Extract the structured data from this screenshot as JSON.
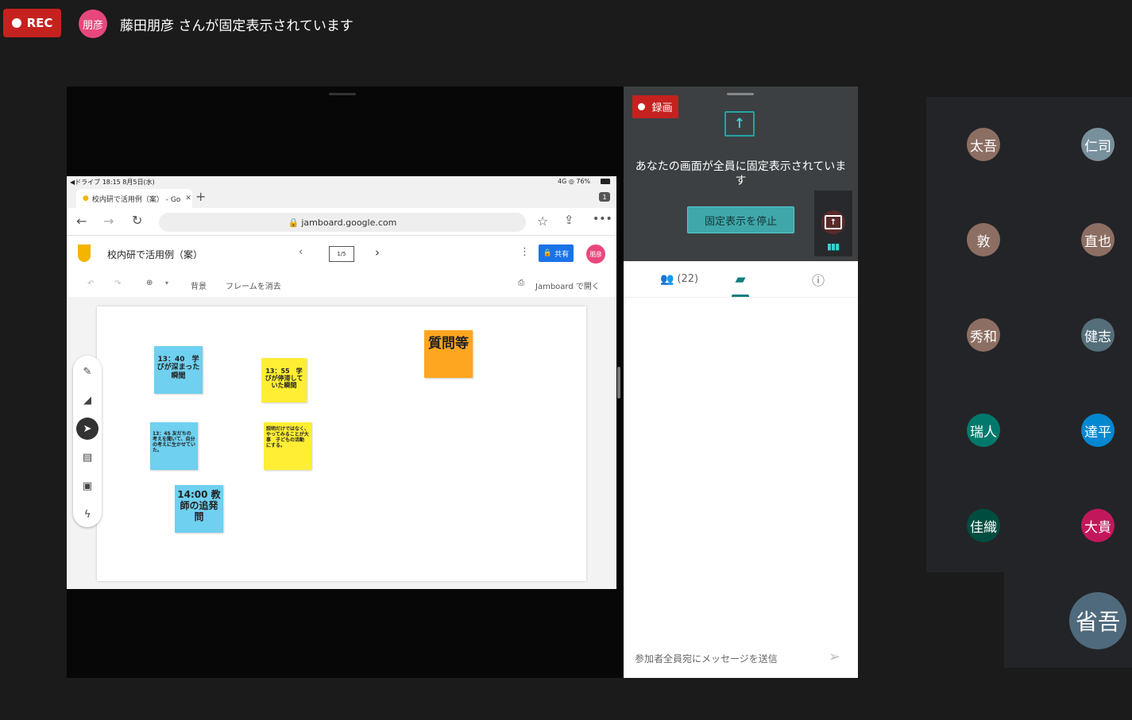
{
  "top_bar": {
    "rec_label": "REC",
    "pinned_avatar": "朋彦",
    "pinned_message": "藤田朋彦 さんが固定表示されています"
  },
  "ipad": {
    "status_left": "◀ドライブ 18:15 8月5日(水)",
    "status_right": "4G ◎ 76%",
    "tab_title": "校内研で活用例（案） - Go",
    "tab_count": "1",
    "url": "jamboard.google.com"
  },
  "jamboard": {
    "title": "校内研で活用例（案）",
    "frame_indicator": "1/5",
    "share_label": "共有",
    "user_avatar": "朋彦",
    "background_label": "背景",
    "clear_frame_label": "フレームを消去",
    "open_in_jamboard": "Jamboard で開く",
    "notes": [
      {
        "text": "13：40　学びが深まった瞬間",
        "color": "#6fd0f0"
      },
      {
        "text": "13：55　学びが停滞していた瞬間",
        "color": "#ffee33"
      },
      {
        "text": "質問等",
        "color": "#ffa621"
      },
      {
        "text": "13：45 友だちの考えを聞いて、自分の考えに生かせていた。",
        "color": "#6fd0f0"
      },
      {
        "text": "説明だけではなく、やってみることが大事　子どもの活動にする。",
        "color": "#ffee33"
      },
      {
        "text": "14:00 教師の追発問",
        "color": "#6fd0f0"
      }
    ]
  },
  "side_panel": {
    "rec_label": "録画",
    "presenting_message": "あなたの画面が全員に固定表示されています",
    "stop_button": "固定表示を停止",
    "people_count": "(22)",
    "chat_placeholder": "参加者全員宛にメッセージを送信"
  },
  "participants": [
    {
      "name": "太吾",
      "color": "#8d6e63"
    },
    {
      "name": "仁司",
      "color": "#78909c"
    },
    {
      "name": "敦",
      "color": "#8d6e63"
    },
    {
      "name": "直也",
      "color": "#8d6e63"
    },
    {
      "name": "秀和",
      "color": "#8d6e63"
    },
    {
      "name": "健志",
      "color": "#546e7a"
    },
    {
      "name": "瑞人",
      "color": "#00796b"
    },
    {
      "name": "達平",
      "color": "#0288d1"
    },
    {
      "name": "佳織",
      "color": "#004d40"
    },
    {
      "name": "大貴",
      "color": "#c2185b"
    }
  ],
  "self_tile": {
    "name": "省吾",
    "color": "#4f6a7c"
  }
}
